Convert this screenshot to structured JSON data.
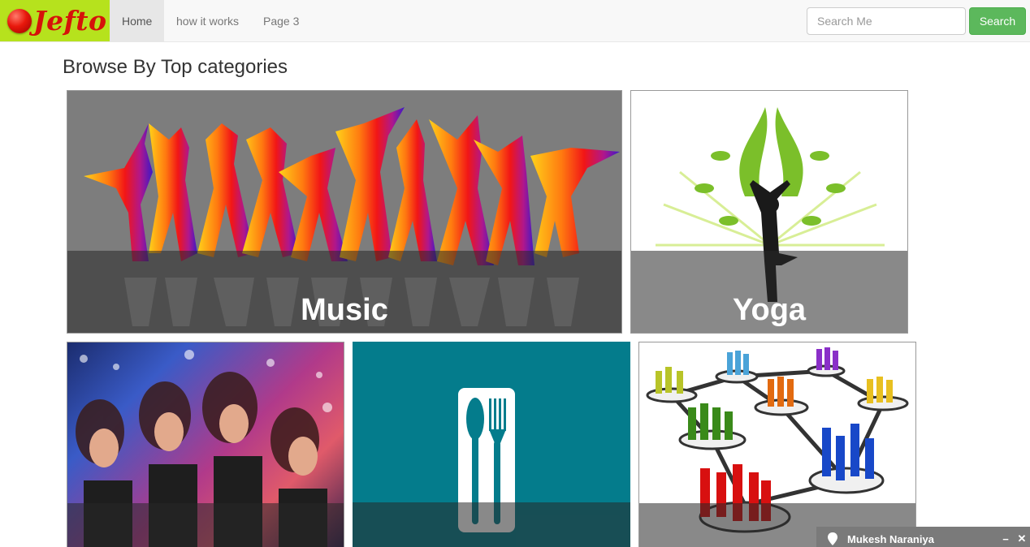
{
  "brand": {
    "name": "Jefto",
    "bg_color": "#b6e21d",
    "text_color": "#d6120a"
  },
  "nav": {
    "items": [
      {
        "label": "Home",
        "active": true
      },
      {
        "label": "how it works",
        "active": false
      },
      {
        "label": "Page 3",
        "active": false
      }
    ]
  },
  "search": {
    "placeholder": "Search Me",
    "button_label": "Search",
    "button_color": "#5cb85c"
  },
  "main": {
    "heading": "Browse By Top categories",
    "categories": [
      {
        "label": "Music",
        "image": "dancing-silhouettes"
      },
      {
        "label": "Yoga",
        "image": "yoga-tree-pose"
      },
      {
        "label": "",
        "image": "party-crowd"
      },
      {
        "label": "",
        "image": "fork-knife-icon"
      },
      {
        "label": "",
        "image": "people-network"
      }
    ]
  },
  "chat": {
    "name": "Mukesh Naraniya",
    "minimize": "−",
    "close": "✕",
    "icon": "map-pin-icon"
  }
}
